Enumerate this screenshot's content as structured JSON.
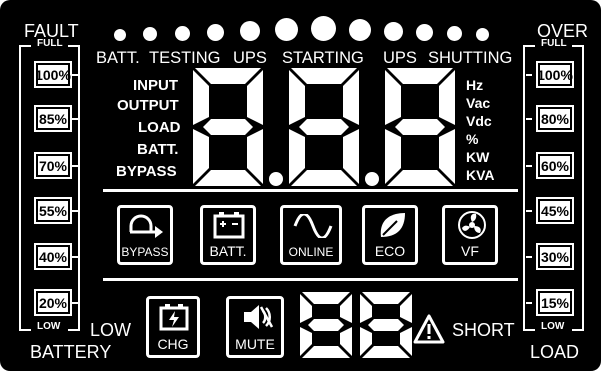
{
  "left_bar": {
    "top_label": "FAULT",
    "full_label": "FULL",
    "low_label": "LOW",
    "bottom_label": "BATTERY",
    "side_label": "LOW",
    "levels": [
      "100%",
      "85%",
      "70%",
      "55%",
      "40%",
      "20%"
    ]
  },
  "right_bar": {
    "top_label": "OVER",
    "full_label": "FULL",
    "low_label": "LOW",
    "bottom_label": "LOAD",
    "side_label": "SHORT",
    "levels": [
      "100%",
      "80%",
      "60%",
      "45%",
      "30%",
      "15%"
    ]
  },
  "status_words": [
    "BATT.",
    "TESTING",
    "UPS",
    "STARTING",
    "UPS",
    "SHUTTING"
  ],
  "measure_labels": [
    "INPUT",
    "OUTPUT",
    "LOAD",
    "BATT.",
    "BYPASS"
  ],
  "units": [
    "Hz",
    "Vac",
    "Vdc",
    "%",
    "KW",
    "KVA"
  ],
  "main_display": "8.8.8",
  "small_display": "88",
  "modes": [
    {
      "label": "BYPASS",
      "icon": "bypass-arrow-icon"
    },
    {
      "label": "BATT.",
      "icon": "battery-icon"
    },
    {
      "label": "ONLINE",
      "icon": "sine-wave-icon"
    },
    {
      "label": "ECO",
      "icon": "leaf-icon"
    },
    {
      "label": "VF",
      "icon": "fan-icon"
    }
  ],
  "bottom_icons": [
    {
      "label": "CHG",
      "icon": "charging-battery-icon"
    },
    {
      "label": "MUTE",
      "icon": "speaker-mute-icon"
    }
  ],
  "warning_icon": "warning-triangle-icon",
  "colors": {
    "background": "#000000",
    "segment": "#ffffff"
  }
}
